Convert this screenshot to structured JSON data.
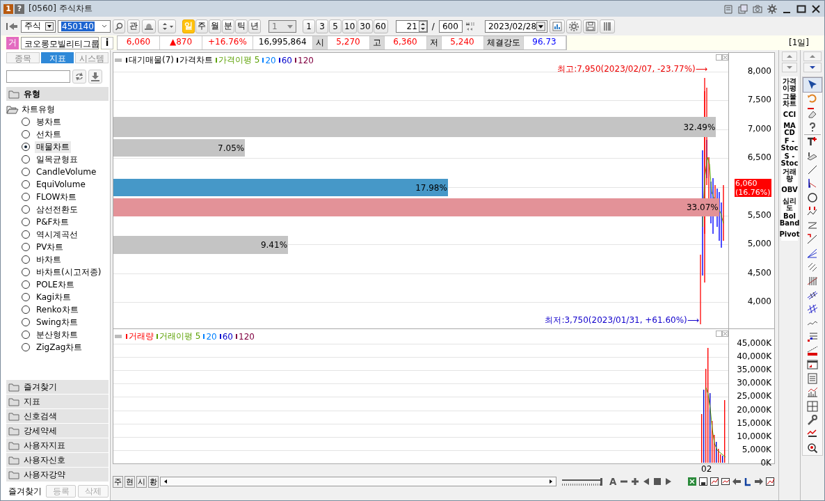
{
  "window": {
    "badges": [
      "1",
      "?"
    ],
    "title": "[0560] 주식차트"
  },
  "toolbar": {
    "market": "주식",
    "code": "450140",
    "related": "관",
    "periods": [
      {
        "label": "일",
        "selected": true
      },
      {
        "label": "주",
        "selected": false
      },
      {
        "label": "월",
        "selected": false
      },
      {
        "label": "분",
        "selected": false
      },
      {
        "label": "틱",
        "selected": false
      },
      {
        "label": "년",
        "selected": false
      }
    ],
    "unit": "1",
    "intervals": [
      "1",
      "3",
      "5",
      "10",
      "30",
      "60"
    ],
    "count": "21",
    "slash": "/",
    "total": "600",
    "date": "2023/02/28"
  },
  "quote": {
    "badge": "거",
    "name": "코오롱모빌리티그룹",
    "info": "i",
    "cells": [
      {
        "kind": "value",
        "text": "6,060",
        "color": "#ff0000"
      },
      {
        "kind": "value",
        "text": "▲870",
        "color": "#ff0000"
      },
      {
        "kind": "value",
        "text": "+16.76%",
        "color": "#ff0000"
      },
      {
        "kind": "value",
        "text": "16,995,864",
        "color": "#000000"
      },
      {
        "kind": "label",
        "text": "시"
      },
      {
        "kind": "value",
        "text": "5,270",
        "color": "#ff0000"
      },
      {
        "kind": "label",
        "text": "고"
      },
      {
        "kind": "value",
        "text": "6,360",
        "color": "#ff0000"
      },
      {
        "kind": "label",
        "text": "저"
      },
      {
        "kind": "value",
        "text": "5,240",
        "color": "#ff0000"
      },
      {
        "kind": "label",
        "text": "체결강도"
      },
      {
        "kind": "value",
        "text": "96.73",
        "color": "#0000ff"
      }
    ],
    "period": "[1일]"
  },
  "sidebar": {
    "tabs": [
      {
        "label": "종목",
        "selected": false
      },
      {
        "label": "지표",
        "selected": true
      },
      {
        "label": "시스템",
        "selected": false
      }
    ],
    "folder": "유형",
    "tree": {
      "label": "차트유형",
      "expanded": true,
      "children": [
        {
          "label": "봉차트",
          "selected": false
        },
        {
          "label": "선차트",
          "selected": false
        },
        {
          "label": "매물차트",
          "selected": true
        },
        {
          "label": "일목균형표",
          "selected": false
        },
        {
          "label": "CandleVolume",
          "selected": false
        },
        {
          "label": "EquiVolume",
          "selected": false
        },
        {
          "label": "FLOW차트",
          "selected": false
        },
        {
          "label": "삼선전환도",
          "selected": false
        },
        {
          "label": "P&F차트",
          "selected": false
        },
        {
          "label": "역시계곡선",
          "selected": false
        },
        {
          "label": "PV차트",
          "selected": false
        },
        {
          "label": "바차트",
          "selected": false
        },
        {
          "label": "바차트(시고저종)",
          "selected": false
        },
        {
          "label": "POLE차트",
          "selected": false
        },
        {
          "label": "Kagi차트",
          "selected": false
        },
        {
          "label": "Renko차트",
          "selected": false
        },
        {
          "label": "Swing차트",
          "selected": false
        },
        {
          "label": "분산형차트",
          "selected": false
        },
        {
          "label": "ZigZag차트",
          "selected": false
        }
      ]
    },
    "folders": [
      "즐겨찾기",
      "지표",
      "신호검색",
      "강세약세",
      "사용자지표",
      "사용자신호",
      "사용자강약"
    ],
    "buttons": [
      {
        "label": "즐겨찾기",
        "disabled": false
      },
      {
        "label": "등록",
        "disabled": true
      },
      {
        "label": "삭제",
        "disabled": true
      }
    ]
  },
  "price_panel": {
    "legend": [
      {
        "text": "대기매물(7)",
        "color": "#000000"
      },
      {
        "text": "가격차트",
        "color": "#000000"
      },
      {
        "text": "가격이평 5",
        "color": "#5aa000"
      },
      {
        "text": "20",
        "color": "#0080ff"
      },
      {
        "text": "60",
        "color": "#0000cc"
      },
      {
        "text": "120",
        "color": "#800040"
      }
    ],
    "profile": [
      {
        "label": "32.49%",
        "level": 0.98,
        "color": "#c4c4c4"
      },
      {
        "label": "7.05%",
        "level": 0.214,
        "color": "#c4c4c4"
      },
      {
        "label": "17.98%",
        "level": 0.544,
        "color": "#4698c8"
      },
      {
        "label": "33.07%",
        "level": 0.985,
        "color": "#e39298"
      },
      {
        "label": "9.41%",
        "level": 0.284,
        "color": "#c4c4c4"
      }
    ],
    "yticks": [
      "8,000",
      "7,500",
      "7,000",
      "6,500",
      "5,500",
      "5,000",
      "4,500",
      "4,000"
    ],
    "high": "최고:7,950(2023/02/07, -23.77%)⟶",
    "low": "최저:3,750(2023/01/31, +61.60%)⟶",
    "tag": [
      "6,060",
      "(16.76%)"
    ]
  },
  "volume_panel": {
    "legend": [
      {
        "text": "거래량",
        "color": "#ff0000"
      },
      {
        "text": "거래이평 5",
        "color": "#5aa000"
      },
      {
        "text": "20",
        "color": "#0080ff"
      },
      {
        "text": "60",
        "color": "#0000cc"
      },
      {
        "text": "120",
        "color": "#800040"
      }
    ],
    "yticks": [
      "45,000K",
      "40,000K",
      "35,000K",
      "30,000K",
      "25,000K",
      "20,000K",
      "15,000K",
      "10,000K",
      "5,000K",
      "0K"
    ],
    "xlabel": "02"
  },
  "bottom": {
    "tabs": [
      "주",
      "현",
      "시",
      "황"
    ],
    "zoom": {
      "level": 1
    },
    "font": "A"
  },
  "indicators": [
    [
      "가격",
      "이평"
    ],
    [
      "그물",
      "차트"
    ],
    [
      "CCI"
    ],
    [
      "MA",
      "CD"
    ],
    [
      "F -",
      "Stoc"
    ],
    [
      "S -",
      "Stoc"
    ],
    [
      "거래",
      "량"
    ],
    [
      "OBV"
    ],
    [
      "심리",
      "도"
    ],
    [
      "Bol",
      "Band"
    ],
    [
      "Pivot"
    ]
  ]
}
